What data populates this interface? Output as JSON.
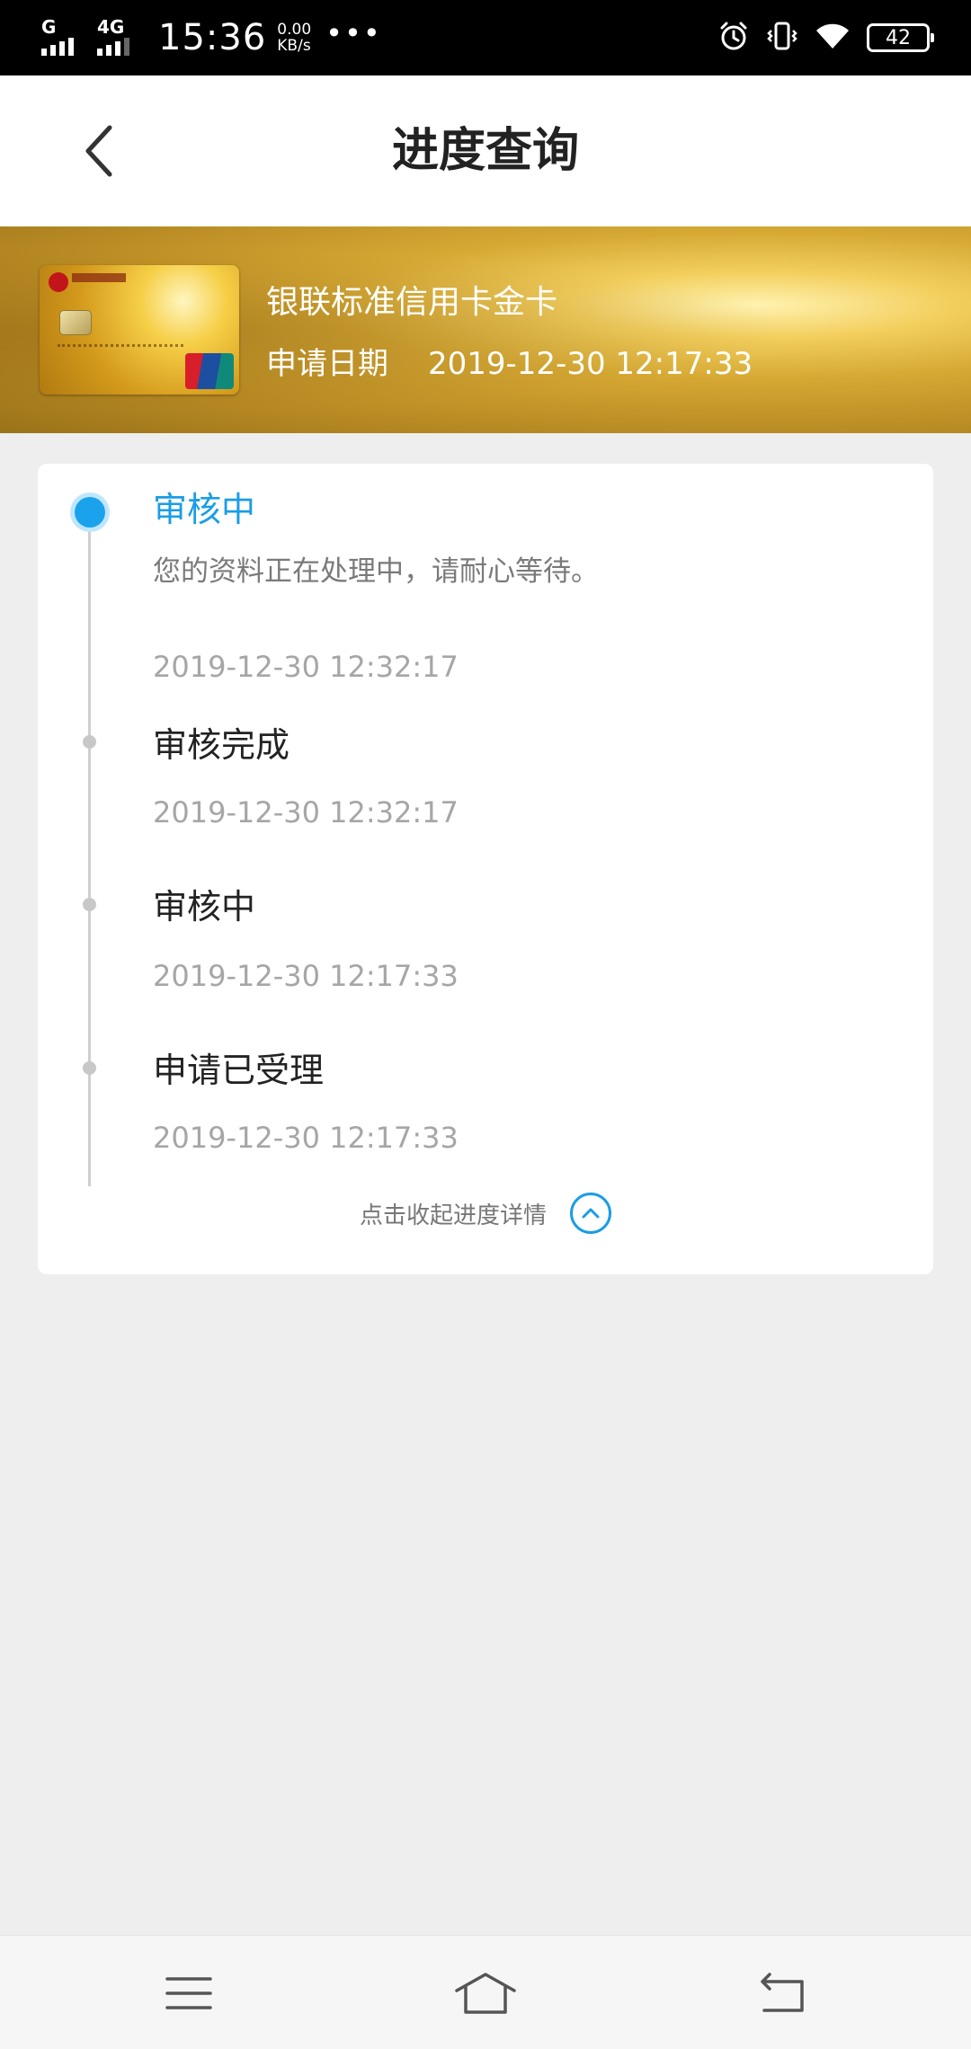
{
  "status_bar": {
    "network": "G",
    "network2": "4G",
    "time": "15:36",
    "speed_value": "0.00",
    "speed_unit": "KB/s",
    "more": "•••",
    "battery": "42",
    "icons": [
      "alarm-icon",
      "vibrate-icon",
      "wifi-icon",
      "battery-icon"
    ]
  },
  "header": {
    "title": "进度查询",
    "back_icon": "chevron-left-icon"
  },
  "card": {
    "name": "银联标准信用卡金卡",
    "date_label": "申请日期",
    "date_value": "2019-12-30 12:17:33"
  },
  "timeline": {
    "current": {
      "title": "审核中",
      "description": "您的资料正在处理中，请耐心等待。",
      "time": "2019-12-30 12:32:17"
    },
    "history": [
      {
        "title": "审核完成",
        "time": "2019-12-30 12:32:17"
      },
      {
        "title": "审核中",
        "time": "2019-12-30 12:17:33"
      },
      {
        "title": "申请已受理",
        "time": "2019-12-30 12:17:33"
      }
    ],
    "collapse_label": "点击收起进度详情",
    "collapse_icon": "chevron-up-circle-icon"
  },
  "nav_bar": {
    "items": [
      "menu-icon",
      "home-icon",
      "back-icon"
    ]
  },
  "colors": {
    "accent": "#1a9de6",
    "title_text": "#222222",
    "secondary_text": "#a6a6a6",
    "background": "#eeeeee"
  }
}
